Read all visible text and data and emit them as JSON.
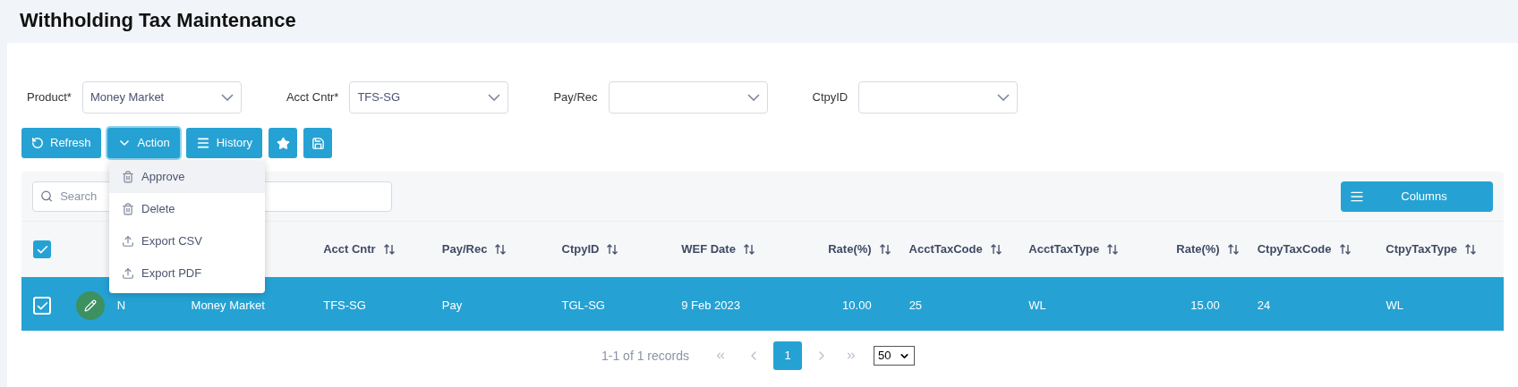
{
  "page_title": "Withholding Tax Maintenance",
  "filters": [
    {
      "label": "Product*",
      "value": "Money Market"
    },
    {
      "label": "Acct Cntr*",
      "value": "TFS-SG"
    },
    {
      "label": "Pay/Rec"
    },
    {
      "label": "CtpyID"
    }
  ],
  "toolbar": [
    {
      "kind": "refresh",
      "label": "Refresh",
      "expanded": false
    },
    {
      "kind": "action",
      "label": "Action",
      "expanded": true
    },
    {
      "kind": "history",
      "label": "History",
      "expanded": false
    },
    {
      "kind": "favorite",
      "expanded": false
    },
    {
      "kind": "save",
      "expanded": false
    }
  ],
  "action_menu": [
    {
      "kind": "remove",
      "label": "Approve",
      "selected": true
    },
    {
      "kind": "remove",
      "label": "Delete",
      "selected": false
    },
    {
      "kind": "export",
      "label": "Export CSV",
      "selected": false
    },
    {
      "kind": "export",
      "label": "Export PDF",
      "selected": false
    }
  ],
  "search": {
    "placeholder": "Search"
  },
  "columns_button": {
    "label": "Columns"
  },
  "table": {
    "all_checked": true,
    "columns": [
      {
        "label": "Acct Cntr",
        "kind": "text"
      },
      {
        "label": "Pay/Rec",
        "kind": "text"
      },
      {
        "label": "CtpyID",
        "kind": "text"
      },
      {
        "label": "WEF Date",
        "kind": "text"
      },
      {
        "label": "Rate(%)",
        "kind": "number"
      },
      {
        "label": "AcctTaxCode",
        "kind": "text"
      },
      {
        "label": "AcctTaxType",
        "kind": "text"
      },
      {
        "label": "Rate(%)",
        "kind": "number"
      },
      {
        "label": "CtpyTaxCode",
        "kind": "text"
      },
      {
        "label": "CtpyTaxType",
        "kind": "text"
      }
    ],
    "rows": [
      {
        "checked": true,
        "selected": true,
        "status": "N",
        "product": "Money Market",
        "cells": [
          "TFS-SG",
          "Pay",
          "TGL-SG",
          "9 Feb 2023",
          "10.00",
          "25",
          "WL",
          "15.00",
          "24",
          "WL"
        ]
      }
    ]
  },
  "pagination": {
    "summary": "1-1 of 1 records",
    "pages": [
      {
        "label": "1",
        "selected": true
      }
    ],
    "page_size": "50"
  }
}
